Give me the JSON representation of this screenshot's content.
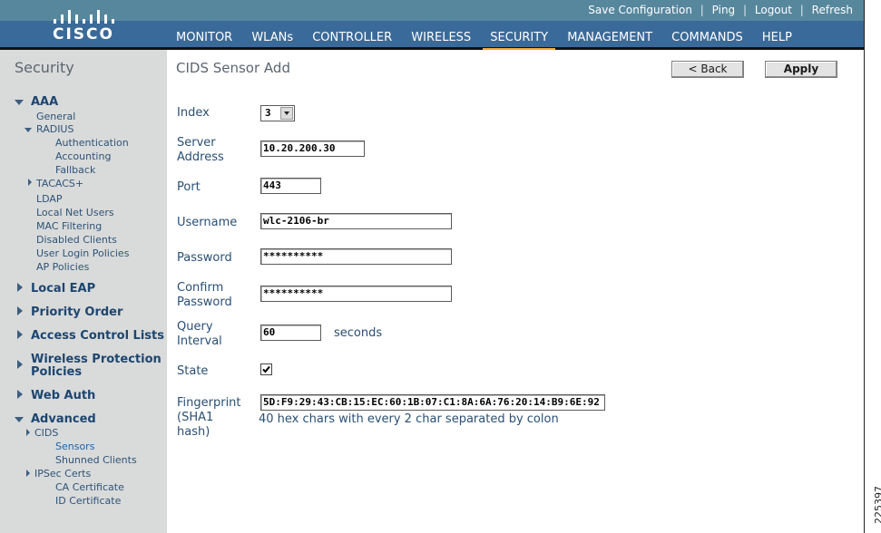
{
  "header": {
    "logo_text": "CISCO",
    "top_links": [
      "Save Configuration",
      "Ping",
      "Logout",
      "Refresh"
    ],
    "nav": [
      {
        "label": "MONITOR",
        "active": false
      },
      {
        "label": "WLANs",
        "active": false
      },
      {
        "label": "CONTROLLER",
        "active": false
      },
      {
        "label": "WIRELESS",
        "active": false
      },
      {
        "label": "SECURITY",
        "active": true
      },
      {
        "label": "MANAGEMENT",
        "active": false
      },
      {
        "label": "COMMANDS",
        "active": false
      },
      {
        "label": "HELP",
        "active": false
      }
    ],
    "active_tab_color": "#f2a93b"
  },
  "sidebar": {
    "title": "Security",
    "items": {
      "aaa": "AAA",
      "general": "General",
      "radius": "RADIUS",
      "authentication": "Authentication",
      "accounting": "Accounting",
      "fallback": "Fallback",
      "tacacs": "TACACS+",
      "ldap": "LDAP",
      "local_net_users": "Local Net Users",
      "mac_filtering": "MAC Filtering",
      "disabled_clients": "Disabled Clients",
      "user_login_policies": "User Login Policies",
      "ap_policies": "AP Policies",
      "local_eap": "Local EAP",
      "priority_order": "Priority Order",
      "acl": "Access Control Lists",
      "wireless_protection_1": "Wireless Protection",
      "wireless_protection_2": "Policies",
      "web_auth": "Web Auth",
      "advanced": "Advanced",
      "cids": "CIDS",
      "sensors": "Sensors",
      "shunned_clients": "Shunned Clients",
      "ipsec_certs": "IPSec Certs",
      "ca_certificate": "CA Certificate",
      "id_certificate": "ID Certificate"
    }
  },
  "main": {
    "title": "CIDS Sensor Add",
    "back_label": "< Back",
    "apply_label": "Apply",
    "form": {
      "index_label": "Index",
      "index_value": "3",
      "server_label_1": "Server",
      "server_label_2": "Address",
      "server_value": "10.20.200.30",
      "port_label": "Port",
      "port_value": "443",
      "username_label": "Username",
      "username_value": "wlc-2106-br",
      "password_label": "Password",
      "password_value": "**********",
      "confirm_label_1": "Confirm",
      "confirm_label_2": "Password",
      "confirm_value": "**********",
      "query_label_1": "Query",
      "query_label_2": "Interval",
      "query_value": "60",
      "query_unit": "seconds",
      "state_label": "State",
      "state_checked": true,
      "fingerprint_label_1": "Fingerprint",
      "fingerprint_label_2": "(SHA1",
      "fingerprint_label_3": "hash)",
      "fingerprint_value": "5D:F9:29:43:CB:15:EC:60:1B:07:C1:8A:6A:76:20:14:B9:6E:92",
      "fingerprint_hint": "40 hex chars with every 2 char separated by colon"
    }
  },
  "figure_id": "225397"
}
